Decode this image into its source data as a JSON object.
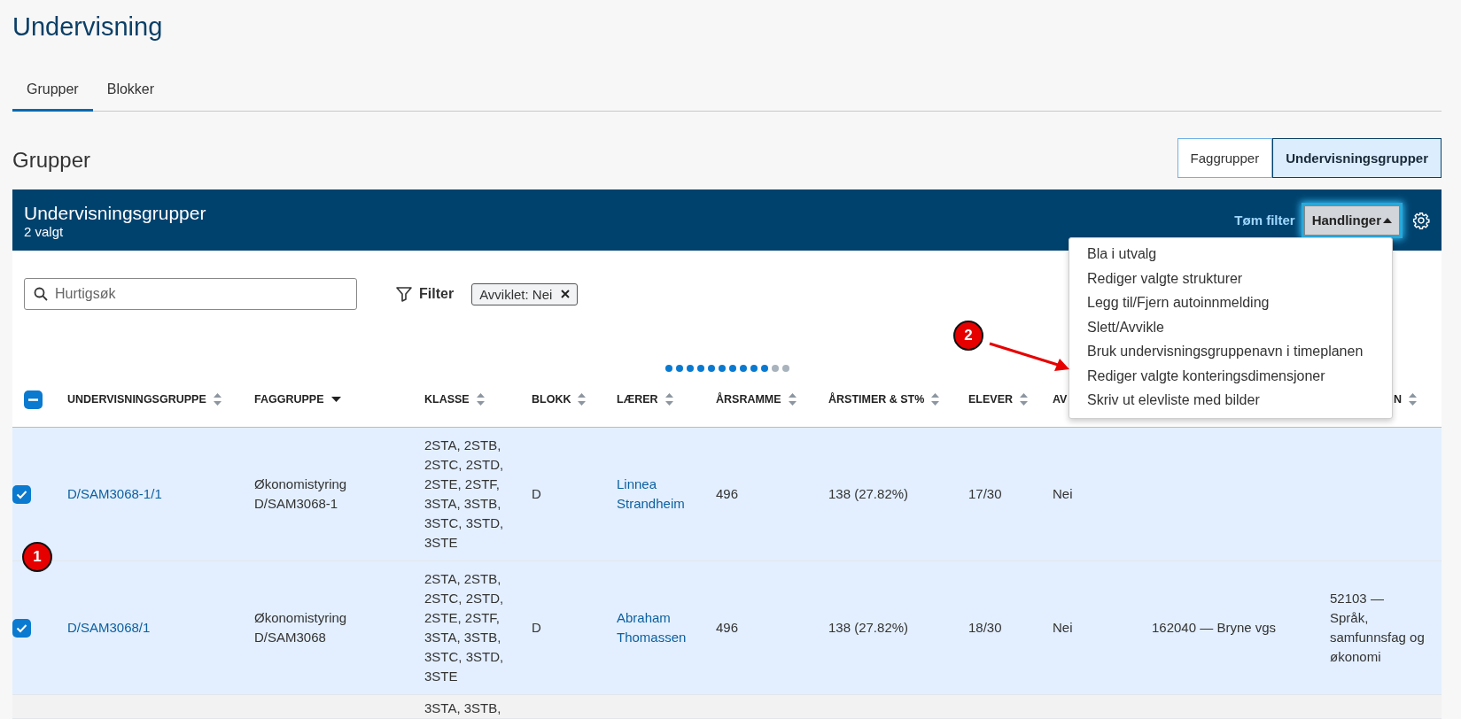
{
  "page_title": "Undervisning",
  "tabs": [
    {
      "label": "Grupper",
      "selected": true
    },
    {
      "label": "Blokker",
      "selected": false
    }
  ],
  "section_title": "Grupper",
  "view_toggle": [
    {
      "label": "Faggrupper",
      "selected": false
    },
    {
      "label": "Undervisningsgrupper",
      "selected": true
    }
  ],
  "panel": {
    "title": "Undervisningsgrupper",
    "subtitle": "2 valgt",
    "clear_filter": "Tøm filter",
    "actions_button": {
      "label": "Handlinger",
      "expanded": true
    },
    "actions_menu": [
      "Bla i utvalg",
      "Rediger valgte strukturer",
      "Legg til/Fjern autoinnmelding",
      "Slett/Avvikle",
      "Bruk undervisningsgruppenavn i timeplanen",
      "Rediger valgte konteringsdimensjoner",
      "Skriv ut elevliste med bilder"
    ]
  },
  "search": {
    "placeholder": "Hurtigsøk"
  },
  "filter": {
    "label": "Filter",
    "chips": [
      "Avviklet: Nei"
    ]
  },
  "scroll_dots": [
    {
      "selected": true
    },
    {
      "selected": true
    },
    {
      "selected": true
    },
    {
      "selected": true
    },
    {
      "selected": true
    },
    {
      "selected": true
    },
    {
      "selected": true
    },
    {
      "selected": true
    },
    {
      "selected": true
    },
    {
      "selected": true
    },
    {
      "selected": false
    },
    {
      "selected": false
    }
  ],
  "table": {
    "select_all": {
      "checked": true,
      "indeterminate": true
    },
    "columns": [
      {
        "label": "UNDERVISNINGSGRUPPE",
        "sortable": true,
        "link": true
      },
      {
        "label": "FAGGRUPPE",
        "sorted": true
      },
      {
        "label": "KLASSE",
        "sortable": true
      },
      {
        "label": "BLOKK",
        "sortable": true
      },
      {
        "label": "LÆRER",
        "sortable": true,
        "link": true
      },
      {
        "label": "ÅRSRAMME",
        "sortable": true
      },
      {
        "label": "ÅRSTIMER & ST%",
        "sortable": true
      },
      {
        "label": "ELEVER",
        "sortable": true
      },
      {
        "label": "AV"
      },
      {},
      {
        "label": "N",
        "sortable": true
      }
    ],
    "rows": [
      {
        "selected": true,
        "cells": [
          "D/SAM3068-1/1",
          "Økonomistyring D/SAM3068-1",
          "2STA, 2STB, 2STC, 2STD, 2STE, 2STF, 3STA, 3STB, 3STC, 3STD, 3STE",
          "D",
          "Linnea Strandheim",
          "496",
          "138 (27.82%)",
          "17/30",
          "Nei",
          null,
          null
        ]
      },
      {
        "selected": true,
        "cells": [
          "D/SAM3068/1",
          "Økonomistyring D/SAM3068",
          "2STA, 2STB, 2STC, 2STD, 2STE, 2STF, 3STA, 3STB, 3STC, 3STD, 3STE",
          "D",
          "Abraham Thomassen",
          "496",
          "138 (27.82%)",
          "18/30",
          "Nei",
          "162040 — Bryne vgs",
          "52103 — Språk, samfunnsfag og økonomi"
        ]
      },
      {
        "selected": false,
        "cells": [
          null,
          null,
          "3STA, 3STB,",
          null,
          null,
          null,
          null,
          null,
          null,
          null,
          null
        ]
      }
    ]
  },
  "annotations": [
    {
      "label": "1"
    },
    {
      "label": "2",
      "arrow": true
    }
  ]
}
